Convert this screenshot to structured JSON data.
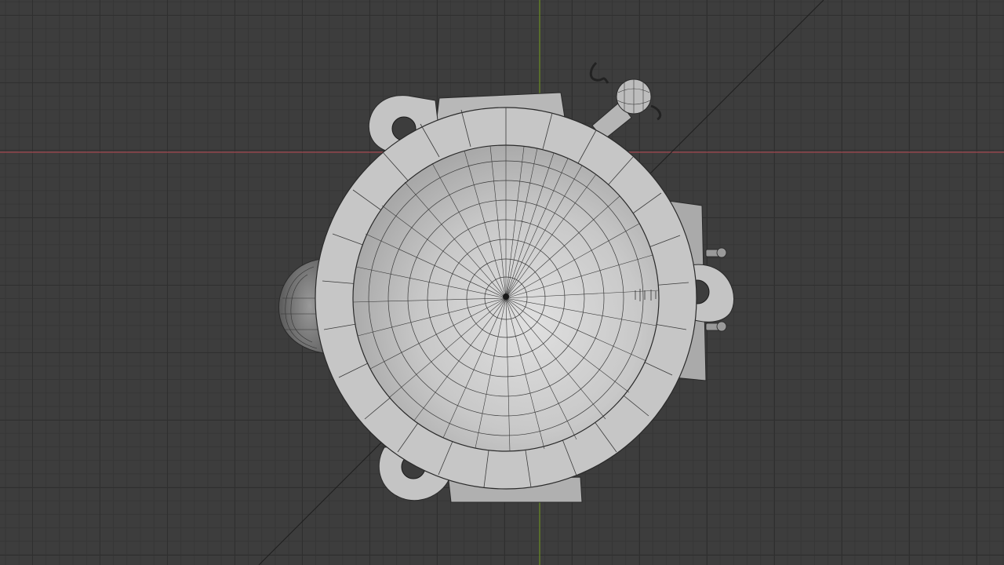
{
  "viewport": {
    "background_color": "#3d3d3d",
    "grid_major_color": "#2f2f2f",
    "grid_minor_color": "#363636",
    "x_axis_color": "#a3474f",
    "y_axis_color": "#6b8e23",
    "diagonal_axis_color": "#1e1e1e"
  },
  "model": {
    "mesh_color": "#c4c4c4",
    "mesh_highlight_color": "#d8d8d8",
    "wireframe_color": "#2a2a2a",
    "display_mode": "solid-with-wireframe"
  }
}
